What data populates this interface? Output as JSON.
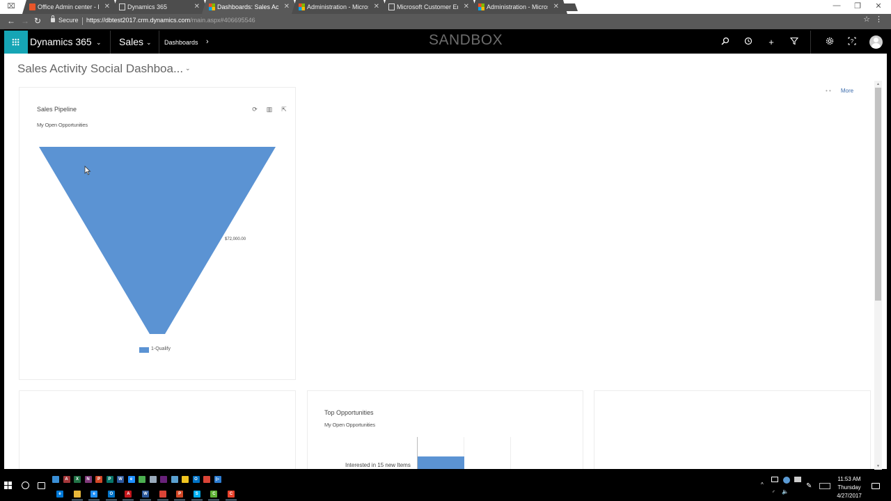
{
  "browser": {
    "tabs": [
      {
        "title": "Office Admin center - Ho",
        "favicon": "office-icon",
        "active": false
      },
      {
        "title": "Dynamics 365",
        "favicon": "page-icon",
        "active": false
      },
      {
        "title": "Dashboards: Sales Activi",
        "favicon": "microsoft-icon",
        "active": true
      },
      {
        "title": "Administration - Microsc",
        "favicon": "microsoft-icon",
        "active": false
      },
      {
        "title": "Microsoft Customer Eng",
        "favicon": "page-icon",
        "active": false
      },
      {
        "title": "Administration - Microsc",
        "favicon": "microsoft-icon",
        "active": false
      }
    ],
    "tab_close_glyph": "✕",
    "window_controls": {
      "minimize": "—",
      "restore": "❐",
      "close": "✕"
    },
    "address": {
      "secure_label": "Secure",
      "url_host": "https://dbtest2017.crm.dynamics.com",
      "url_path": "/main.aspx#406695546"
    },
    "nav": {
      "back": "←",
      "forward": "→",
      "reload": "↻",
      "star": "☆",
      "menu": "⋮"
    }
  },
  "dynamics_nav": {
    "app_name": "Dynamics 365",
    "module": "Sales",
    "breadcrumb": "Dashboards",
    "chevron_down": "⌄",
    "chevron_right": "›",
    "environment_label": "SANDBOX",
    "icons": {
      "search": "⚲",
      "recent": "⟲",
      "new": "+",
      "filter": "⏷",
      "settings": "⚙",
      "help": "?"
    }
  },
  "dashboard": {
    "title": "Sales Activity Social Dashboa...",
    "title_chevron": "⌄",
    "more_dots": "• •",
    "more_label": "More",
    "panels": {
      "sales_pipeline": {
        "title": "Sales Pipeline",
        "view": "My Open Opportunities",
        "tools": {
          "refresh": "⟳",
          "view_records": "▥",
          "expand": "⇱"
        }
      },
      "top_opportunities": {
        "title": "Top Opportunities",
        "view": "My Open Opportunities"
      }
    }
  },
  "chart_data": [
    {
      "type": "funnel",
      "title": "Sales Pipeline",
      "subtitle": "My Open Opportunities",
      "categories": [
        "1-Qualify"
      ],
      "values": [
        72000
      ],
      "data_labels": [
        "$72,000.00"
      ],
      "legend": [
        "1-Qualify"
      ],
      "legend_position": "bottom",
      "color": "#5b93d3"
    },
    {
      "type": "bar",
      "orientation": "horizontal",
      "title": "Top Opportunities",
      "subtitle": "My Open Opportunities",
      "categories": [
        "Interested in 15 new Items"
      ],
      "values": [
        1
      ],
      "xlim": [
        0,
        3
      ],
      "grid": true,
      "color": "#5b93d3"
    }
  ],
  "taskbar": {
    "pinned_top": [
      {
        "name": "remote-desktop",
        "color": "#3a8fd6",
        "label": ""
      },
      {
        "name": "access",
        "color": "#a4373a",
        "label": "A"
      },
      {
        "name": "excel",
        "color": "#217346",
        "label": "X"
      },
      {
        "name": "onenote",
        "color": "#80397b",
        "label": "N"
      },
      {
        "name": "powerpoint",
        "color": "#d24726",
        "label": "P"
      },
      {
        "name": "publisher",
        "color": "#077568",
        "label": "P"
      },
      {
        "name": "word",
        "color": "#2b579a",
        "label": "W"
      },
      {
        "name": "internet-explorer",
        "color": "#1e90ff",
        "label": "e"
      },
      {
        "name": "user-app",
        "color": "#4caf50",
        "label": ""
      },
      {
        "name": "recycle-bin",
        "color": "#9ab",
        "label": ""
      },
      {
        "name": "visual-studio",
        "color": "#68217a",
        "label": ""
      },
      {
        "name": "paint",
        "color": "#5aa0d0",
        "label": ""
      },
      {
        "name": "app-yellow",
        "color": "#f0c420",
        "label": ""
      },
      {
        "name": "outlook",
        "color": "#0072c6",
        "label": "O"
      },
      {
        "name": "chrome",
        "color": "#db4437",
        "label": ""
      },
      {
        "name": "media",
        "color": "#2d7dd2",
        "label": "▷"
      }
    ],
    "pinned_bottom": [
      {
        "name": "edge",
        "color": "#0078d7",
        "label": "e",
        "running": false
      },
      {
        "name": "file-explorer",
        "color": "#e8b83a",
        "label": "",
        "running": true
      },
      {
        "name": "internet-explorer",
        "color": "#1e90ff",
        "label": "e",
        "running": true
      },
      {
        "name": "outlook",
        "color": "#0072c6",
        "label": "O",
        "running": true
      },
      {
        "name": "acrobat",
        "color": "#c4161c",
        "label": "A",
        "running": true
      },
      {
        "name": "word",
        "color": "#2b579a",
        "label": "W",
        "running": true
      },
      {
        "name": "chrome",
        "color": "#db4437",
        "label": "",
        "running": true
      },
      {
        "name": "powerpoint",
        "color": "#d24726",
        "label": "P",
        "running": true
      },
      {
        "name": "skype",
        "color": "#00aff0",
        "label": "S",
        "running": true
      },
      {
        "name": "camtasia-green",
        "color": "#5fb336",
        "label": "C",
        "running": true
      },
      {
        "name": "camtasia-red",
        "color": "#e8412b",
        "label": "C",
        "running": true
      }
    ],
    "clock": {
      "time": "11:53 AM",
      "day": "Thursday",
      "date": "4/27/2017"
    },
    "tray": {
      "chevron": "^",
      "wifi": "◜",
      "volume": "🔈"
    }
  }
}
